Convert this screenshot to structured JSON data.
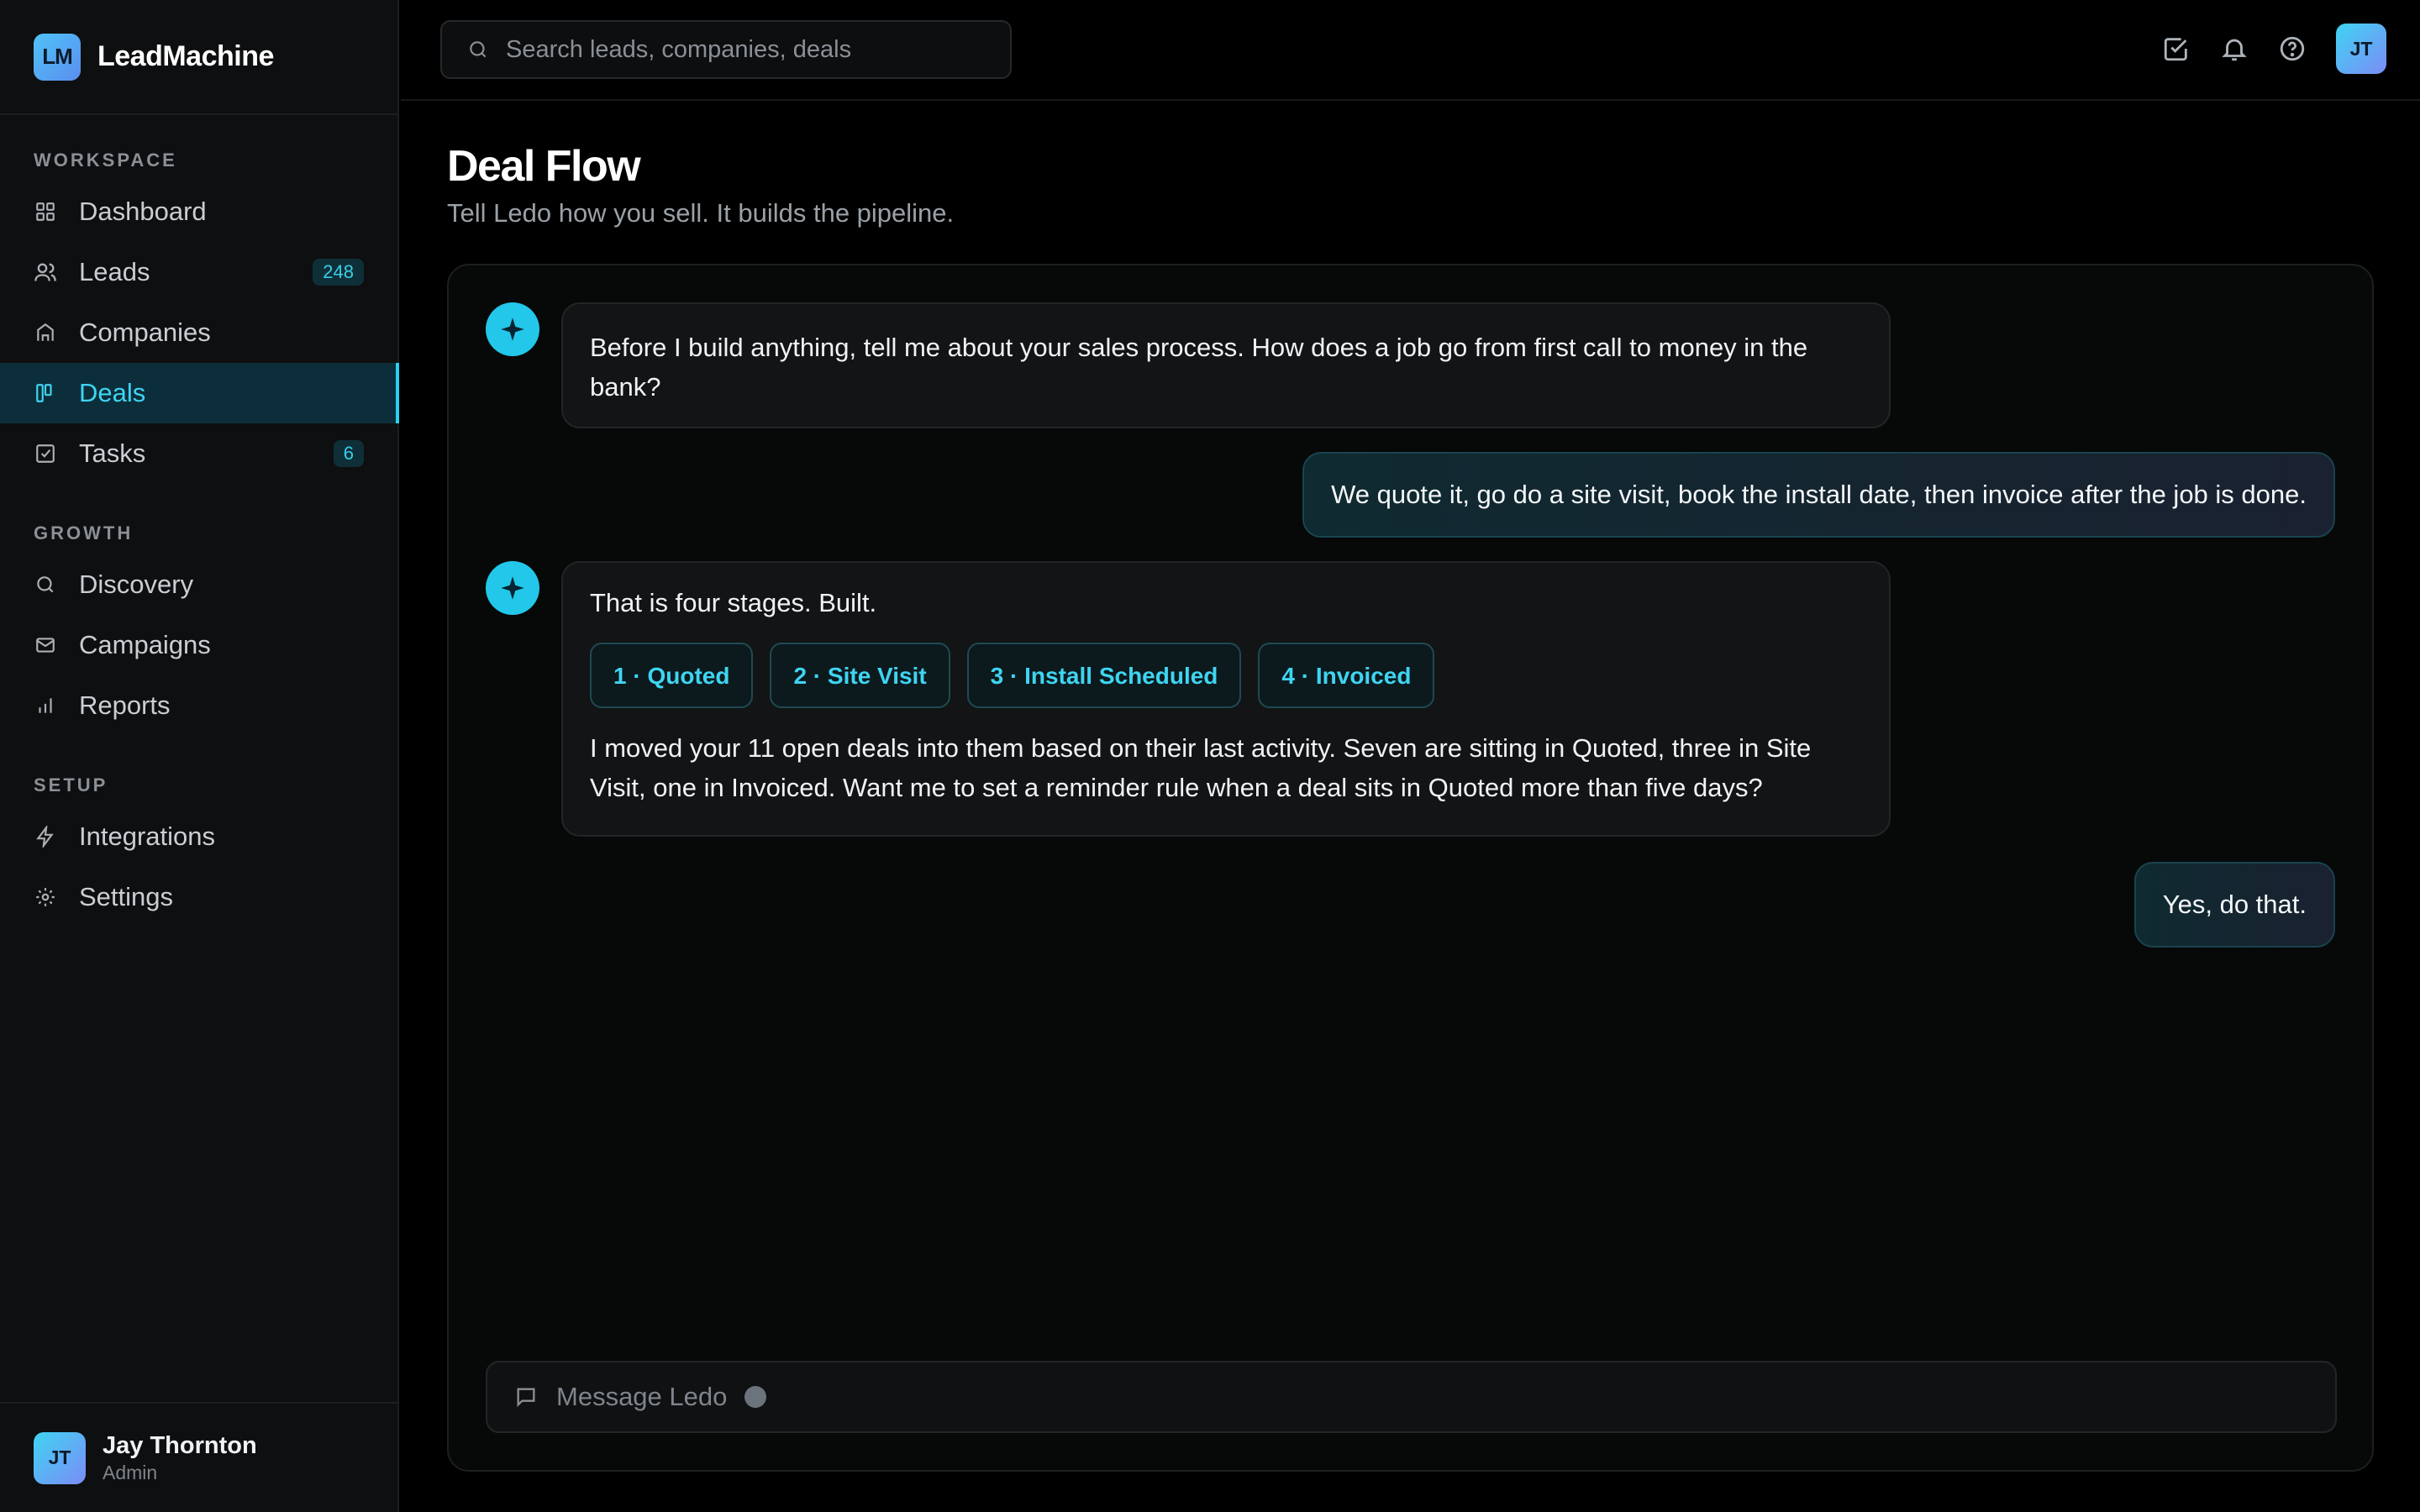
{
  "brand": {
    "logo_text": "LM",
    "name": "LeadMachine"
  },
  "sidebar": {
    "sections": [
      {
        "label": "WORKSPACE",
        "items": [
          {
            "label": "Dashboard",
            "icon": "grid-icon",
            "badge": ""
          },
          {
            "label": "Leads",
            "icon": "users-icon",
            "badge": "248"
          },
          {
            "label": "Companies",
            "icon": "building-icon",
            "badge": ""
          },
          {
            "label": "Deals",
            "icon": "kanban-icon",
            "badge": "",
            "active": true
          },
          {
            "label": "Tasks",
            "icon": "checkbox-icon",
            "badge": "6"
          }
        ]
      },
      {
        "label": "GROWTH",
        "items": [
          {
            "label": "Discovery",
            "icon": "search-icon",
            "badge": ""
          },
          {
            "label": "Campaigns",
            "icon": "mail-icon",
            "badge": ""
          },
          {
            "label": "Reports",
            "icon": "bar-chart-icon",
            "badge": ""
          }
        ]
      },
      {
        "label": "SETUP",
        "items": [
          {
            "label": "Integrations",
            "icon": "lightning-icon",
            "badge": ""
          },
          {
            "label": "Settings",
            "icon": "gear-icon",
            "badge": ""
          }
        ]
      }
    ],
    "user": {
      "initials": "JT",
      "name": "Jay Thornton",
      "role": "Admin"
    }
  },
  "topbar": {
    "search_placeholder": "Search leads, companies, deals",
    "icons": [
      "tasks-check-icon",
      "bell-icon",
      "help-icon"
    ],
    "avatar_initials": "JT"
  },
  "page": {
    "title": "Deal Flow",
    "subtitle": "Tell Ledo how you sell. It builds the pipeline."
  },
  "chat": {
    "messages": [
      {
        "role": "assistant",
        "text": "Before I build anything, tell me about your sales process. How does a job go from first call to money in the bank?"
      },
      {
        "role": "user",
        "text": "We quote it, go do a site visit, book the install date, then invoice after the job is done."
      },
      {
        "role": "assistant",
        "text": "That is four stages. Built.",
        "stages": [
          "1 · Quoted",
          "2 · Site Visit",
          "3 · Install Scheduled",
          "4 · Invoiced"
        ],
        "followup": "I moved your 11 open deals into them based on their last activity. Seven are sitting in Quoted, three in Site Visit, one in Invoiced. Want me to set a reminder rule when a deal sits in Quoted more than five days?"
      },
      {
        "role": "user",
        "text": "Yes, do that."
      }
    ],
    "composer_placeholder": "Message Ledo"
  },
  "colors": {
    "accent": "#22c7ea",
    "background": "#000000",
    "sidebar": "#0e0f10"
  }
}
